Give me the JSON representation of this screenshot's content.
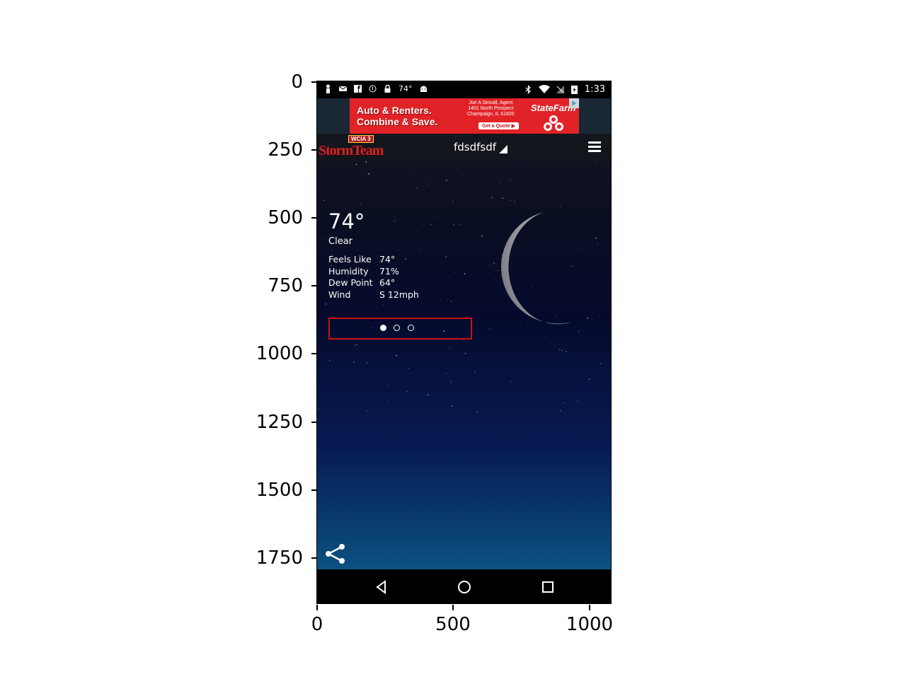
{
  "axes": {
    "yticks": [
      "0",
      "250",
      "500",
      "750",
      "1000",
      "1250",
      "1500",
      "1750"
    ],
    "xticks": [
      "0",
      "500",
      "1000"
    ]
  },
  "status_bar": {
    "left_icons": [
      "person-icon",
      "message-icon",
      "facebook-icon",
      "info-icon",
      "lock-icon"
    ],
    "temperature": "74°",
    "app_icon": "android-icon",
    "right_icons": [
      "bluetooth-icon",
      "wifi-icon",
      "no-signal-icon",
      "battery-charging-icon"
    ],
    "time": "1:33"
  },
  "ad": {
    "headline": "Auto & Renters.\nCombine & Save.",
    "agent": "Joe A Stovall, Agent\n1401 North Prospect\nChampaign, IL 61820",
    "cta": "Get a Quote ▶",
    "brand": "StateFarm"
  },
  "app_bar": {
    "logo_badge": "WCIA 3",
    "logo_text": "StormTeam",
    "location": "fdsdfsdf"
  },
  "weather": {
    "temperature": "74°",
    "condition": "Clear",
    "details": [
      {
        "label": "Feels Like",
        "value": "74°"
      },
      {
        "label": "Humidity",
        "value": "71%"
      },
      {
        "label": "Dew Point",
        "value": "64°"
      },
      {
        "label": "Wind",
        "value": "S 12mph"
      }
    ]
  },
  "pager": {
    "pages": 3,
    "active_page": 1
  },
  "nav_bar": {
    "buttons": [
      "back-icon",
      "home-icon",
      "recents-icon"
    ]
  },
  "colors": {
    "ad_red": "#e12327",
    "highlight_box": "#cc1111",
    "sky_top": "#16181d",
    "sky_bottom": "#0d5f88"
  }
}
